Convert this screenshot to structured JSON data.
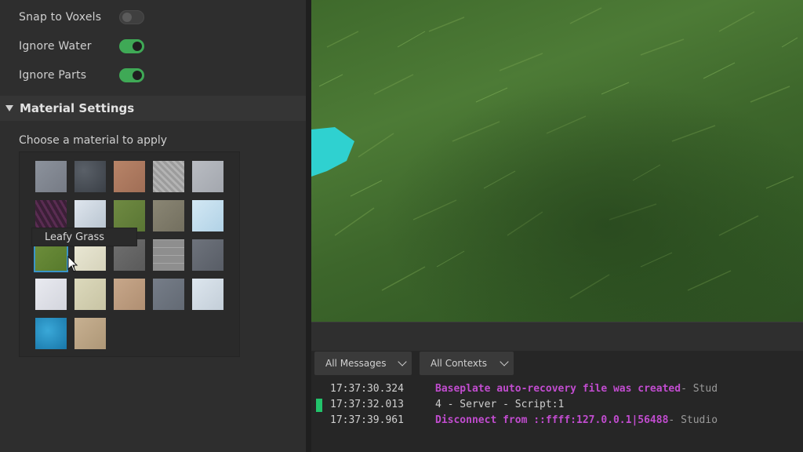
{
  "toggles": [
    {
      "label": "Snap to Voxels",
      "on": false
    },
    {
      "label": "Ignore Water",
      "on": true
    },
    {
      "label": "Ignore Parts",
      "on": true
    }
  ],
  "material_section": {
    "title": "Material Settings",
    "prompt": "Choose a material to apply",
    "tooltip": "Leafy Grass",
    "selected_index": 10
  },
  "output": {
    "filter_messages": "All Messages",
    "filter_contexts": "All Contexts",
    "logs": [
      {
        "time": "17:37:30.324",
        "message": "Baseplate auto-recovery file was created",
        "source": "  -  Stud"
      },
      {
        "time": "17:37:32.013",
        "message": "4  -  Server - Script:1",
        "source": ""
      },
      {
        "time": "17:37:39.961",
        "message": "Disconnect from ::ffff:127.0.0.1|56488",
        "source": "  -  Studio"
      }
    ]
  },
  "colors": {
    "accent_green": "#3fa956",
    "selection_blue": "#3a95c9",
    "log_purple": "#c14ccf",
    "marker_green": "#22c36b"
  }
}
